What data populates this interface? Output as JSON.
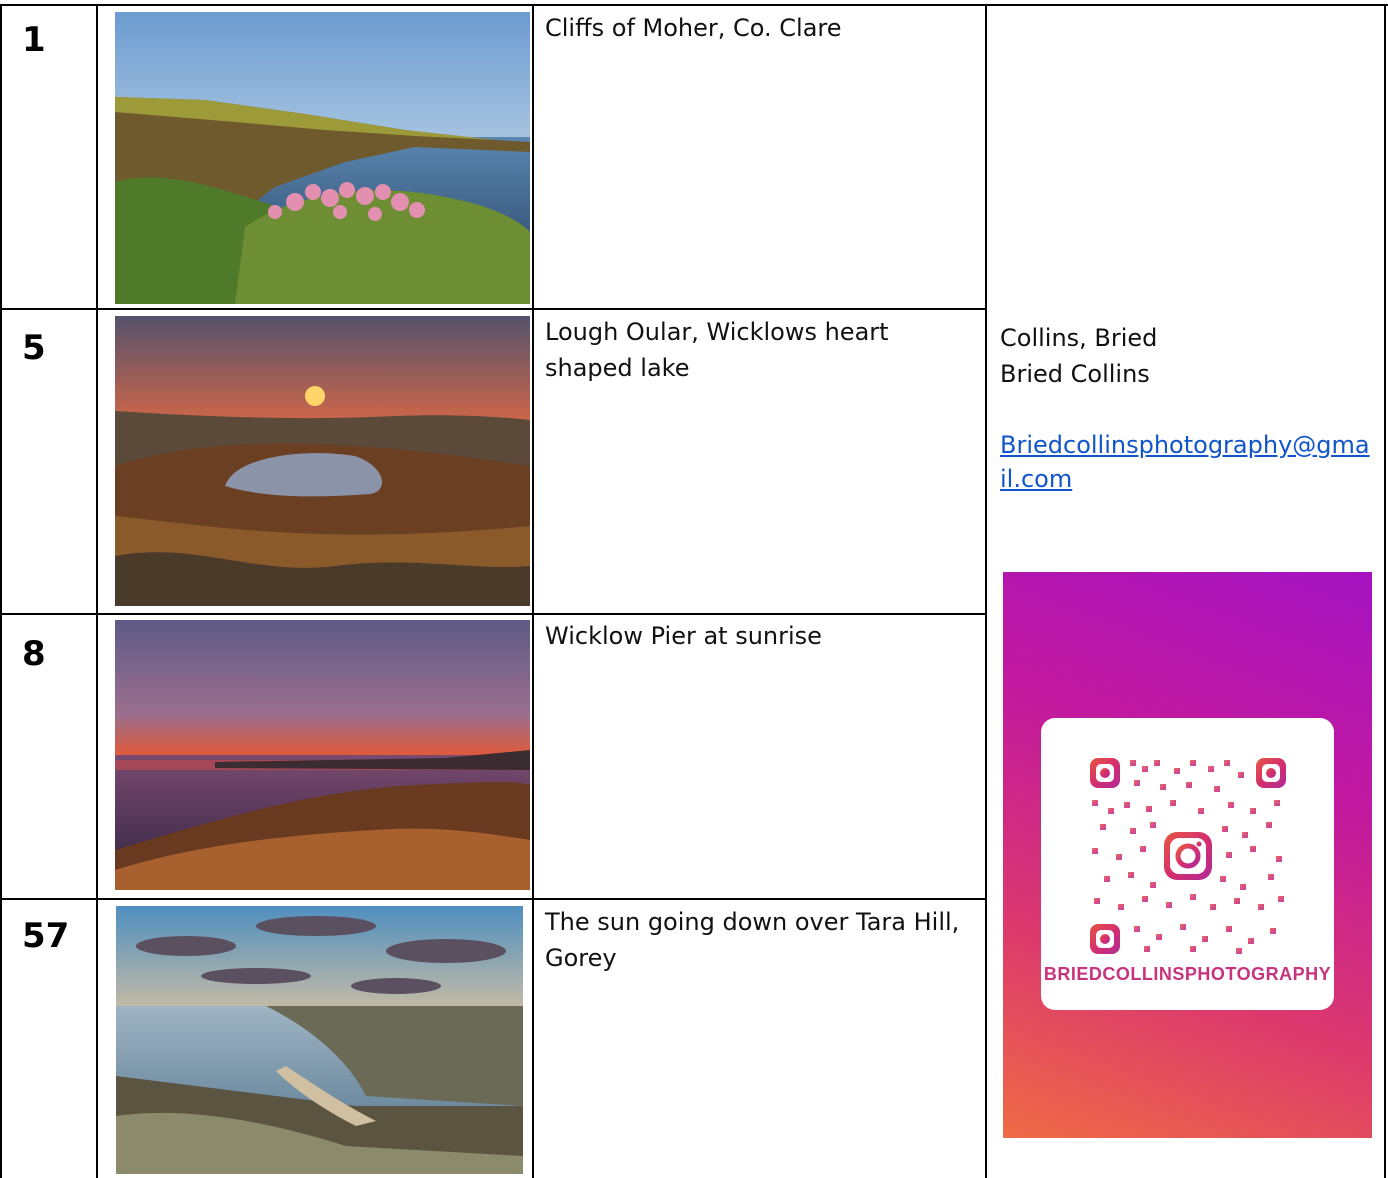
{
  "rows": [
    {
      "number": "1",
      "caption": "Cliffs of Moher, Co. Clare"
    },
    {
      "number": "5",
      "caption": "Lough Oular, Wicklows heart shaped lake"
    },
    {
      "number": "8",
      "caption": "Wicklow Pier at sunrise"
    },
    {
      "number": "57",
      "caption": "The sun going down over Tara Hill, Gorey"
    }
  ],
  "contact": {
    "name_line_1": "Collins, Bried",
    "name_line_2": "Bried Collins",
    "email": "Briedcollinsphotography@gmail.com"
  },
  "instagram": {
    "handle": "BRIEDCOLLINSPHOTOGRAPHY",
    "icon": "instagram-qr-code-icon",
    "gradient_colors": [
      "#a413c1",
      "#c2199e",
      "#dc3a6c",
      "#ef6b45"
    ]
  }
}
